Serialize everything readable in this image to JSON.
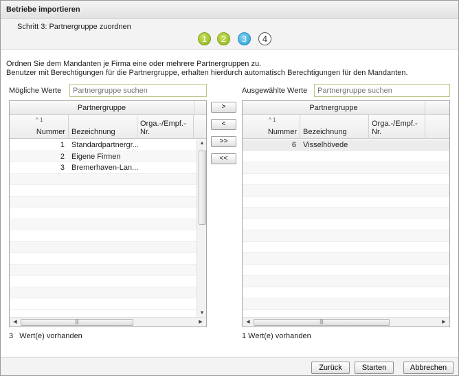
{
  "window": {
    "title": "Betriebe importieren"
  },
  "wizard": {
    "step_label": "Schritt 3: Partnergruppe zuordnen",
    "steps": [
      "1",
      "2",
      "3",
      "4"
    ]
  },
  "description": {
    "line1": "Ordnen Sie dem Mandanten je Firma eine oder mehrere Partnergruppen zu.",
    "line2": "Benutzer mit Berechtigungen für die Partnergruppe, erhalten hierdurch automatisch Berechtigungen für den Mandanten."
  },
  "left": {
    "label": "Mögliche Werte",
    "search_placeholder": "Partnergruppe suchen",
    "group_header": "Partnergruppe",
    "sort_marker": "^ 1",
    "columns": [
      "Nummer",
      "Bezeichnung",
      "Orga.-/Empf.-Nr."
    ],
    "rows": [
      {
        "nummer": "1",
        "bezeichnung": "Standardpartnergr..."
      },
      {
        "nummer": "2",
        "bezeichnung": "Eigene Firmen"
      },
      {
        "nummer": "3",
        "bezeichnung": "Bremerhaven-Lan..."
      }
    ],
    "count_number": "3",
    "count_text": "Wert(e) vorhanden"
  },
  "right": {
    "label": "Ausgewählte Werte",
    "search_placeholder": "Partnergruppe suchen",
    "group_header": "Partnergruppe",
    "sort_marker": "^ 1",
    "columns": [
      "Nummer",
      "Bezeichnung",
      "Orga.-/Empf.-Nr."
    ],
    "rows": [
      {
        "nummer": "6",
        "bezeichnung": "Visselhövede"
      }
    ],
    "count_text": "1 Wert(e) vorhanden"
  },
  "move_buttons": {
    "add": ">",
    "remove": "<",
    "add_all": ">>",
    "remove_all": "<<"
  },
  "footer": {
    "back": "Zurück",
    "start": "Starten",
    "cancel": "Abbrechen"
  },
  "colors": {
    "step_done": "#8cb21e",
    "step_active": "#2a9fd6",
    "search_border": "#b9c98a"
  }
}
